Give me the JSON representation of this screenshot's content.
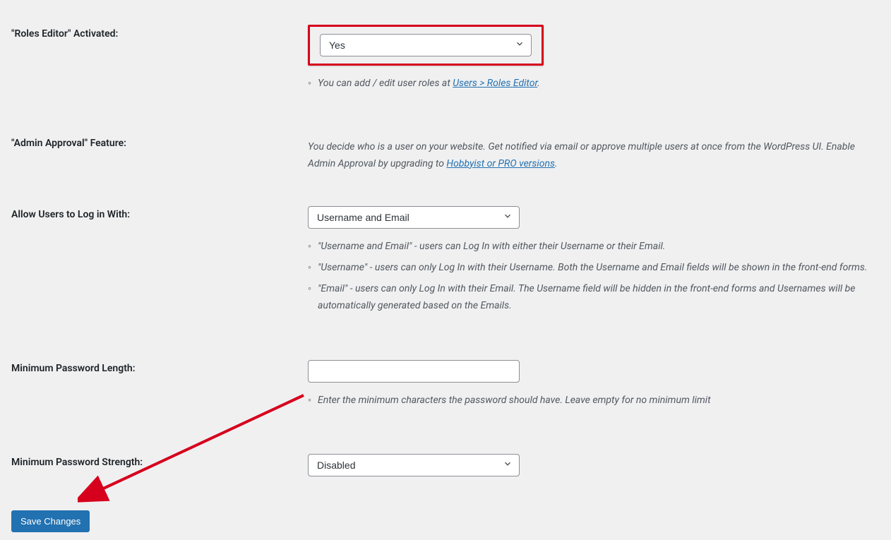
{
  "fields": {
    "roles_editor": {
      "label": "\"Roles Editor\" Activated:",
      "value": "Yes",
      "desc_prefix": "You can add / edit user roles at ",
      "desc_link": "Users > Roles Editor",
      "desc_suffix": "."
    },
    "admin_approval": {
      "label": "\"Admin Approval\" Feature:",
      "desc_prefix": "You decide who is a user on your website. Get notified via email or approve multiple users at once from the WordPress UI. Enable Admin Approval by upgrading to ",
      "desc_link": "Hobbyist or PRO versions",
      "desc_suffix": "."
    },
    "login_with": {
      "label": "Allow Users to Log in With:",
      "value": "Username and Email",
      "opt1": "\"Username and Email\" - users can Log In with either their Username or their Email.",
      "opt2": "\"Username\" - users can only Log In with their Username. Both the Username and Email fields will be shown in the front-end forms.",
      "opt3": "\"Email\" - users can only Log In with their Email. The Username field will be hidden in the front-end forms and Usernames will be automatically generated based on the Emails."
    },
    "min_pw_length": {
      "label": "Minimum Password Length:",
      "value": "",
      "desc": "Enter the minimum characters the password should have. Leave empty for no minimum limit"
    },
    "min_pw_strength": {
      "label": "Minimum Password Strength:",
      "value": "Disabled"
    }
  },
  "buttons": {
    "save": "Save Changes"
  }
}
